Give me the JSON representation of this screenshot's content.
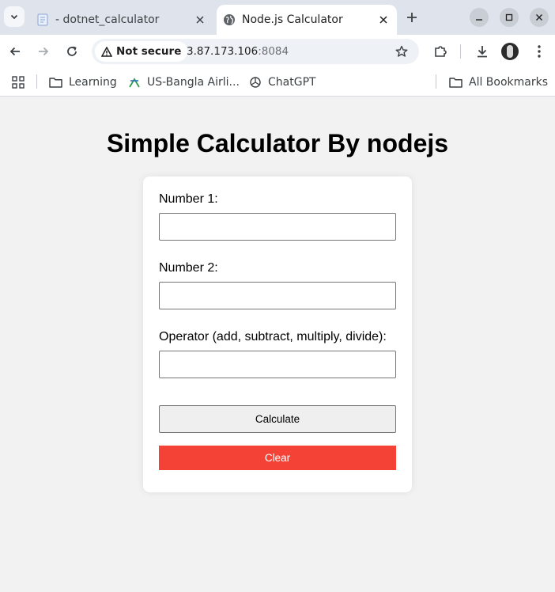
{
  "browser": {
    "tabs": [
      {
        "title": "- dotnet_calculator",
        "favicon": "document-icon",
        "active": false
      },
      {
        "title": "Node.js Calculator",
        "favicon": "globe-icon",
        "active": true
      }
    ],
    "security_label": "Not secure",
    "url_host": "3.87.173.106",
    "url_port": ":8084",
    "bookmarks": [
      {
        "label": "Learning",
        "icon": "folder-icon"
      },
      {
        "label": "US-Bangla Airli...",
        "icon": "airline-icon"
      },
      {
        "label": "ChatGPT",
        "icon": "chatgpt-icon"
      }
    ],
    "all_bookmarks_label": "All Bookmarks"
  },
  "page": {
    "heading": "Simple Calculator By nodejs",
    "form": {
      "number1_label": "Number 1:",
      "number1_value": "",
      "number2_label": "Number 2:",
      "number2_value": "",
      "operator_label": "Operator (add, subtract, multiply, divide):",
      "operator_value": "",
      "calculate_label": "Calculate",
      "clear_label": "Clear"
    }
  },
  "colors": {
    "clear_button": "#f44336",
    "page_background": "#f2f2f2",
    "tabstrip": "#dfe3eb"
  }
}
